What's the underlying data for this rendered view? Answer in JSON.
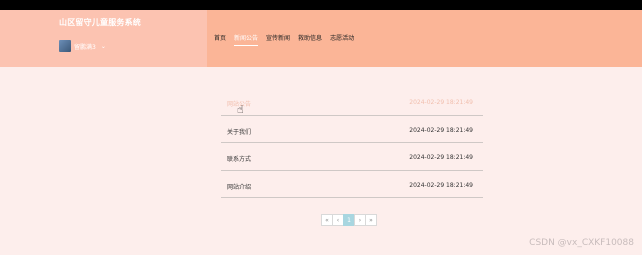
{
  "site_title": "山区留守儿童服务系统",
  "user": {
    "name": "留鹏满3",
    "caret": "⌄"
  },
  "nav": [
    {
      "label": "首页"
    },
    {
      "label": "新闻公告"
    },
    {
      "label": "宣传新闻"
    },
    {
      "label": "救助信息"
    },
    {
      "label": "志愿活动"
    }
  ],
  "nav_active_index": 1,
  "list": [
    {
      "title": "网站公告",
      "date": "2024-02-29 18:21:49"
    },
    {
      "title": "关于我们",
      "date": "2024-02-29 18:21:49"
    },
    {
      "title": "联系方式",
      "date": "2024-02-29 18:21:49"
    },
    {
      "title": "网站介绍",
      "date": "2024-02-29 18:21:49"
    }
  ],
  "pagination": {
    "first": "«",
    "prev": "‹",
    "current": "1",
    "next": "›",
    "last": "»"
  },
  "watermark": "CSDN @vx_CXKF10088",
  "colors": {
    "header": "#fbb597",
    "header_left": "#fcc3b1",
    "page_bg": "#fdeeec",
    "active_page": "#a8d6e0"
  }
}
